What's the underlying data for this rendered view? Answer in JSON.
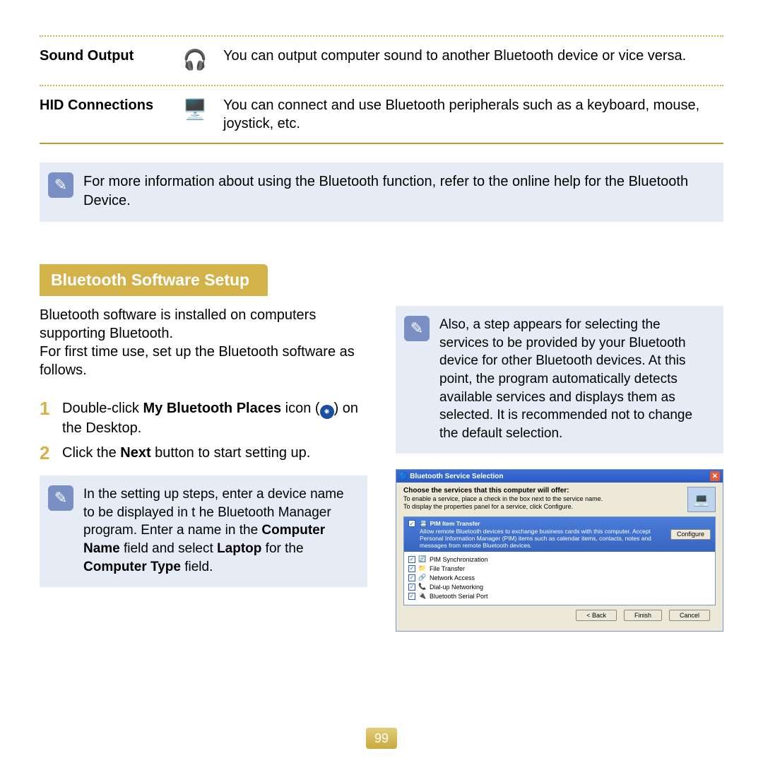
{
  "features": [
    {
      "label": "Sound Output",
      "icon": "headset-icon",
      "glyph": "🎧",
      "desc": "You can output computer sound to another Bluetooth device or vice versa."
    },
    {
      "label": "HID Connections",
      "icon": "peripherals-icon",
      "glyph": "🖥️",
      "desc": "You can connect and use Bluetooth peripherals such as a keyboard, mouse, joystick, etc."
    }
  ],
  "top_note": "For more information about using the Bluetooth function, refer to the online help for the Bluetooth Device.",
  "section_title": "Bluetooth Software Setup",
  "intro_line1": "Bluetooth software is installed on computers supporting Bluetooth.",
  "intro_line2": "For first time use, set up the Bluetooth software as follows.",
  "steps": {
    "s1": {
      "num": "1",
      "pre": "Double-click ",
      "bold": "My Bluetooth Places",
      "mid": " icon (",
      "post": ") on the Desktop."
    },
    "s2": {
      "num": "2",
      "pre": "Click the ",
      "bold": "Next",
      "post": " button to start setting up."
    }
  },
  "left_note": {
    "pre": "In the setting up steps, enter a device name to be displayed in t he Bluetooth Manager program. Enter a name in the ",
    "b1": "Computer Name",
    "mid1": " field and select ",
    "b2": "Laptop",
    "mid2": " for the ",
    "b3": "Computer Type",
    "post": " field."
  },
  "right_note": "Also, a step appears for selecting the services to be provided by your Bluetooth device for other Bluetooth devices. At this point, the program automatically detects available services and displays them as selected. It is recommended not to change the default selection.",
  "xp": {
    "title": "Bluetooth Service Selection",
    "head_bold": "Choose the services that this computer will offer:",
    "head_l1": "To enable a service, place a check in the box next to the service name.",
    "head_l2": "To display the properties panel for a service, click Configure.",
    "pim_title": "PIM Item Transfer",
    "pim_desc": "Allow remote Bluetooth devices to exchange business cards with this computer. Accept Personal Information Manager (PIM) items such as calendar items, contacts, notes and messages from remote Bluetooth devices.",
    "configure": "Configure",
    "services": [
      {
        "name": "PIM Synchronization",
        "glyph": "🔄"
      },
      {
        "name": "File Transfer",
        "glyph": "📁"
      },
      {
        "name": "Network Access",
        "glyph": "🔗"
      },
      {
        "name": "Dial-up Networking",
        "glyph": "📞"
      },
      {
        "name": "Bluetooth Serial Port",
        "glyph": "🔌"
      }
    ],
    "buttons": {
      "back": "< Back",
      "finish": "Finish",
      "cancel": "Cancel"
    }
  },
  "page_number": "99"
}
